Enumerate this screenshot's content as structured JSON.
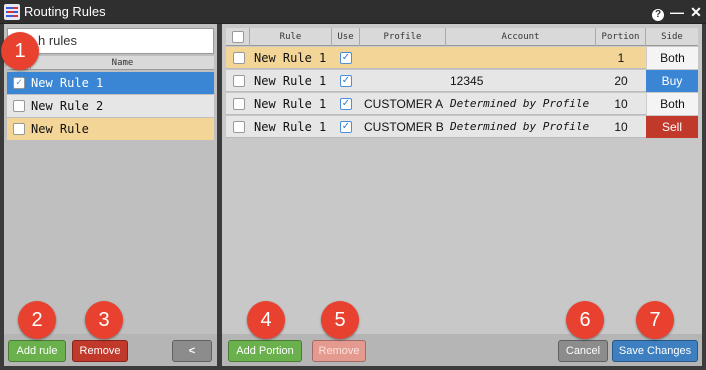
{
  "window": {
    "title": "Routing Rules"
  },
  "left": {
    "search_placeholder": "Search rules",
    "search_visible_text": "h rules",
    "header_name": "Name",
    "items": [
      {
        "label": "New Rule 1",
        "checked": true,
        "state": "selected"
      },
      {
        "label": "New Rule 2",
        "checked": false,
        "state": "plain"
      },
      {
        "label": "New Rule",
        "checked": false,
        "state": "highlight"
      }
    ],
    "add_label": "Add rule",
    "remove_label": "Remove",
    "collapse_glyph": "<"
  },
  "table": {
    "headers": {
      "rule": "Rule",
      "use": "Use",
      "profile": "Profile",
      "account": "Account",
      "portion": "Portion",
      "side": "Side"
    },
    "rows": [
      {
        "rule": "New Rule 1",
        "use": true,
        "profile": "",
        "account": "",
        "portion": "1",
        "side": "Both"
      },
      {
        "rule": "New Rule 1",
        "use": true,
        "profile": "",
        "account": "12345",
        "portion": "20",
        "side": "Buy"
      },
      {
        "rule": "New Rule 1",
        "use": true,
        "profile": "CUSTOMER A",
        "account": "Determined by Profile",
        "portion": "10",
        "side": "Both"
      },
      {
        "rule": "New Rule 1",
        "use": true,
        "profile": "CUSTOMER B",
        "account": "Determined by Profile",
        "portion": "10",
        "side": "Sell"
      }
    ]
  },
  "right": {
    "add_portion_label": "Add Portion",
    "remove_label": "Remove",
    "cancel_label": "Cancel",
    "save_label": "Save Changes"
  },
  "badges": [
    "1",
    "2",
    "3",
    "4",
    "5",
    "6",
    "7"
  ],
  "colors": {
    "selected": "#3b86d4",
    "highlight": "#f2d597",
    "buy": "#3b86d4",
    "sell": "#c0392b",
    "badge": "#e8412f"
  }
}
